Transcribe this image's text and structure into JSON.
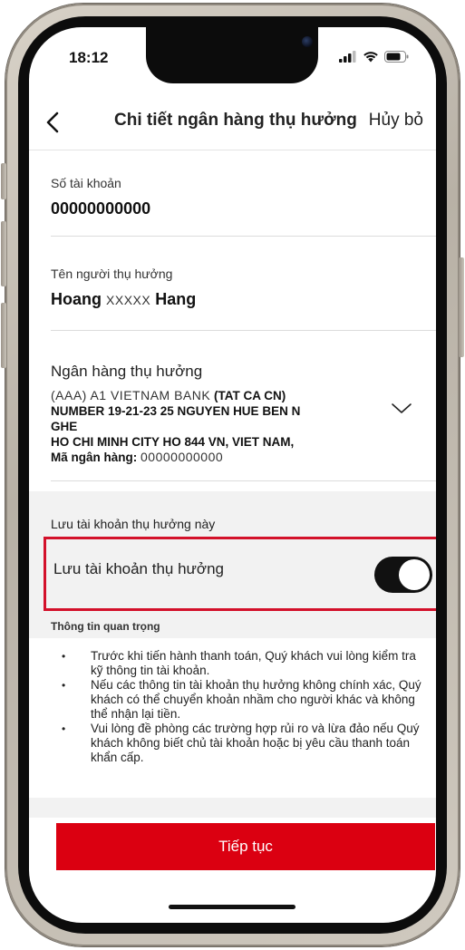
{
  "status": {
    "time": "18:12"
  },
  "nav": {
    "back_icon": "chevron-left-icon",
    "title": "Chi tiết ngân hàng thụ hưởng",
    "cancel": "Hủy bỏ"
  },
  "account": {
    "label": "Số tài khoản",
    "value": "00000000000"
  },
  "beneficiary": {
    "label": "Tên người thụ hưởng",
    "first": "Hoang",
    "middle": "XXXXX",
    "last": "Hang"
  },
  "bank": {
    "label": "Ngân hàng thụ hưởng",
    "name_prefix": "(AAA) A1 VIETNAM BANK",
    "name_suffix": "(TAT CA CN)",
    "address_1": "NUMBER 19-21-23 25 NGUYEN HUE BEN N",
    "address_2": "GHE",
    "address_3": "HO CHI MINH CITY HO 844 VN, VIET NAM,",
    "code_label": "Mã ngân hàng:",
    "code_value": "00000000000"
  },
  "save": {
    "heading": "Lưu tài khoản thụ hưởng này",
    "toggle_label": "Lưu tài khoản thụ hưởng",
    "toggle_on": true
  },
  "info": {
    "heading": "Thông tin quan trọng",
    "items": [
      "Trước khi tiến hành thanh toán, Quý khách vui lòng kiểm tra kỹ thông tin tài khoản.",
      "Nếu các thông tin tài khoản thụ hưởng không chính xác, Quý khách có thể chuyển khoản nhầm cho người khác và không thể nhận lại tiền.",
      "Vui lòng đề phòng các trường hợp rủi ro và lừa đảo nếu Quý khách không biết chủ tài khoản hoặc bị yêu cầu thanh toán khẩn cấp."
    ]
  },
  "continue": "Tiếp tục",
  "colors": {
    "brand_red": "#db0011",
    "highlight_border": "#d3112a",
    "toggle_on": "#111111"
  }
}
